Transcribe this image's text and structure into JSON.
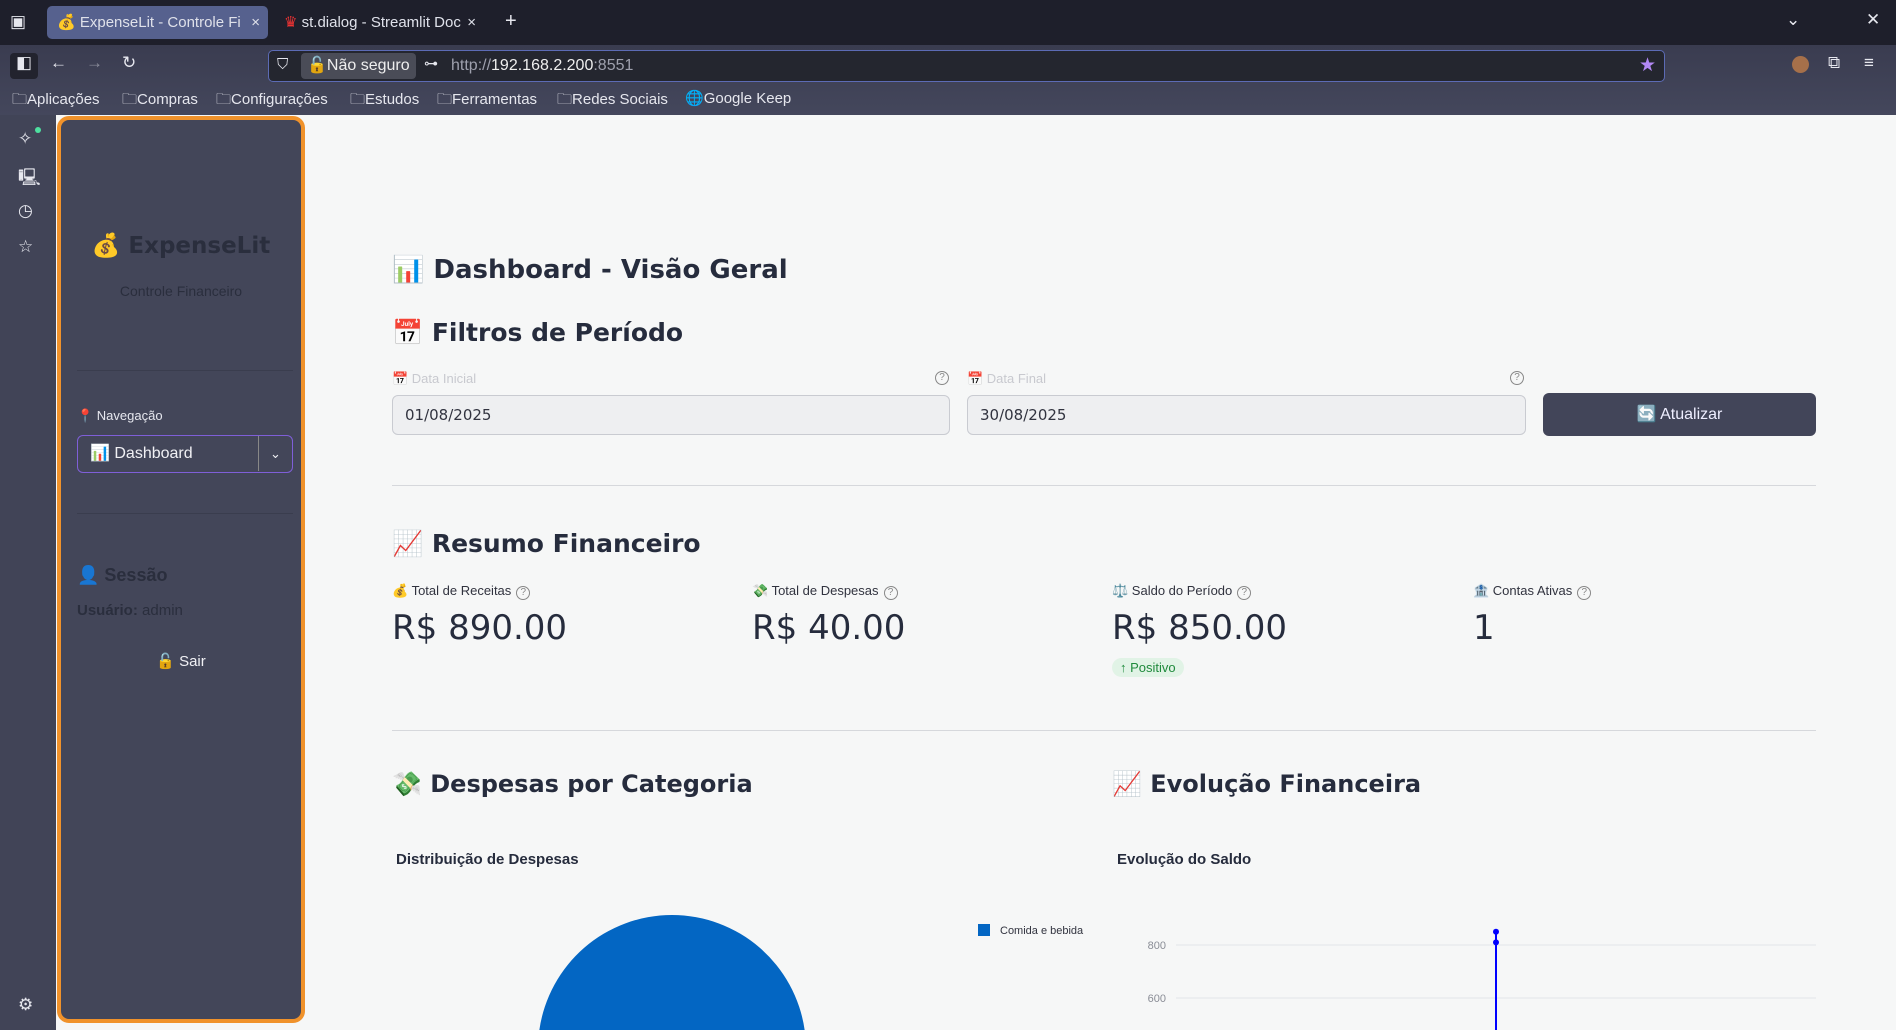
{
  "browser": {
    "tabs": [
      {
        "label": "ExpenseLit - Controle Fi",
        "icon": "money-bag-icon",
        "active": true
      },
      {
        "label": "st.dialog - Streamlit Doc",
        "icon": "streamlit-crown-icon",
        "active": false
      }
    ],
    "security_label": "Não seguro",
    "url_prefix": "http://",
    "url_host": "192.168.2.200",
    "url_port": ":8551",
    "bookmarks": [
      "Aplicações",
      "Compras",
      "Configurações",
      "Estudos",
      "Ferramentas",
      "Redes Sociais",
      "Google Keep"
    ]
  },
  "sidebar": {
    "app_title": "💰 ExpenseLit",
    "app_subtitle": "Controle Financeiro",
    "nav_label": "📍 Navegação",
    "nav_selected": "📊 Dashboard",
    "session_title": "👤 Sessão",
    "user_label": "Usuário:",
    "user_value": "admin",
    "logout_label": "🔓 Sair"
  },
  "main": {
    "title": "📊 Dashboard - Visão Geral",
    "filters_title": "📅 Filtros de Período",
    "start_label": "📅 Data Inicial",
    "start_value": "01/08/2025",
    "end_label": "📅 Data Final",
    "end_value": "30/08/2025",
    "refresh_label": "🔄 Atualizar",
    "summary_title": "📈 Resumo Financeiro",
    "metrics": [
      {
        "label": "💰 Total de Receitas",
        "value": "R$ 890.00"
      },
      {
        "label": "💸 Total de Despesas",
        "value": "R$ 40.00"
      },
      {
        "label": "⚖️ Saldo do Período",
        "value": "R$ 850.00",
        "delta": "↑ Positivo"
      },
      {
        "label": "🏦 Contas Ativas",
        "value": "1"
      }
    ],
    "expenses_title": "💸 Despesas por Categoria",
    "evolution_title": "📈 Evolução Financeira"
  },
  "chart_data": [
    {
      "type": "pie",
      "title": "Distribuição de Despesas",
      "categories": [
        "Comida e bebida"
      ],
      "values": [
        40
      ],
      "colors": [
        "#0366c3"
      ],
      "legend": "right"
    },
    {
      "type": "line",
      "title": "Evolução do Saldo",
      "series": [
        {
          "y": [
            850,
            810
          ],
          "color": "#0000ff"
        }
      ],
      "yticks": [
        600,
        800
      ],
      "grid": true
    }
  ]
}
